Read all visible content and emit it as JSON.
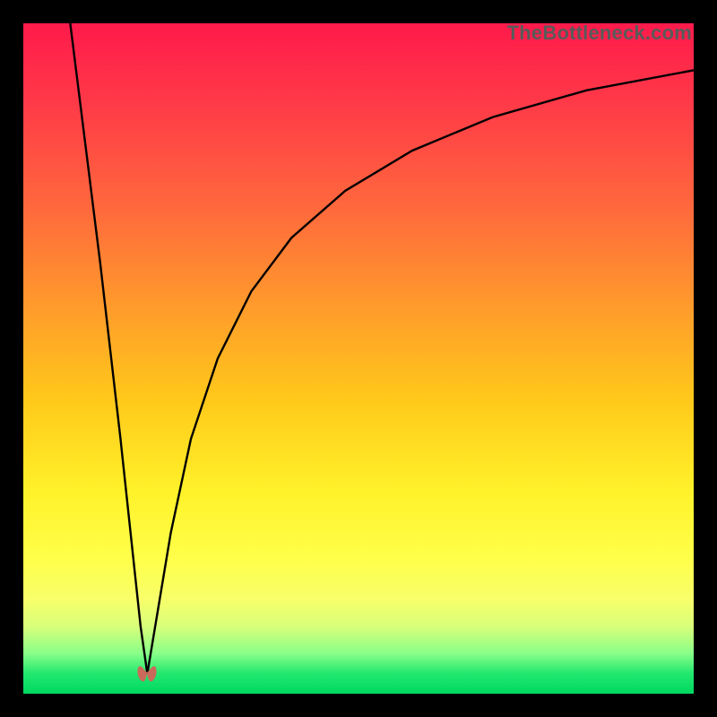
{
  "source_label": "TheBottleneck.com",
  "colors": {
    "frame": "#000000",
    "curve": "#000000",
    "marker": "#c96a5a"
  },
  "chart_data": {
    "type": "line",
    "title": "",
    "xlabel": "",
    "ylabel": "",
    "xlim": [
      0,
      100
    ],
    "ylim": [
      0,
      100
    ],
    "grid": false,
    "legend": false,
    "origin": "top-left",
    "note": "y measured from top of plot downward (0=top, 100=bottom). Two branches of a V-shaped curve meeting near x≈18.5, y≈97.",
    "series": [
      {
        "name": "left-branch",
        "x": [
          7.0,
          8.5,
          10.0,
          11.5,
          13.0,
          14.5,
          16.0,
          17.5,
          18.5
        ],
        "y": [
          0.0,
          12.0,
          24.0,
          36.0,
          49.0,
          62.0,
          76.0,
          90.0,
          97.0
        ]
      },
      {
        "name": "right-branch",
        "x": [
          18.5,
          20.0,
          22.0,
          25.0,
          29.0,
          34.0,
          40.0,
          48.0,
          58.0,
          70.0,
          84.0,
          100.0
        ],
        "y": [
          97.0,
          88.0,
          76.0,
          62.0,
          50.0,
          40.0,
          32.0,
          25.0,
          19.0,
          14.0,
          10.0,
          7.0
        ]
      }
    ],
    "marker": {
      "x": 18.5,
      "y": 97.0,
      "shape": "double-lobe"
    }
  }
}
